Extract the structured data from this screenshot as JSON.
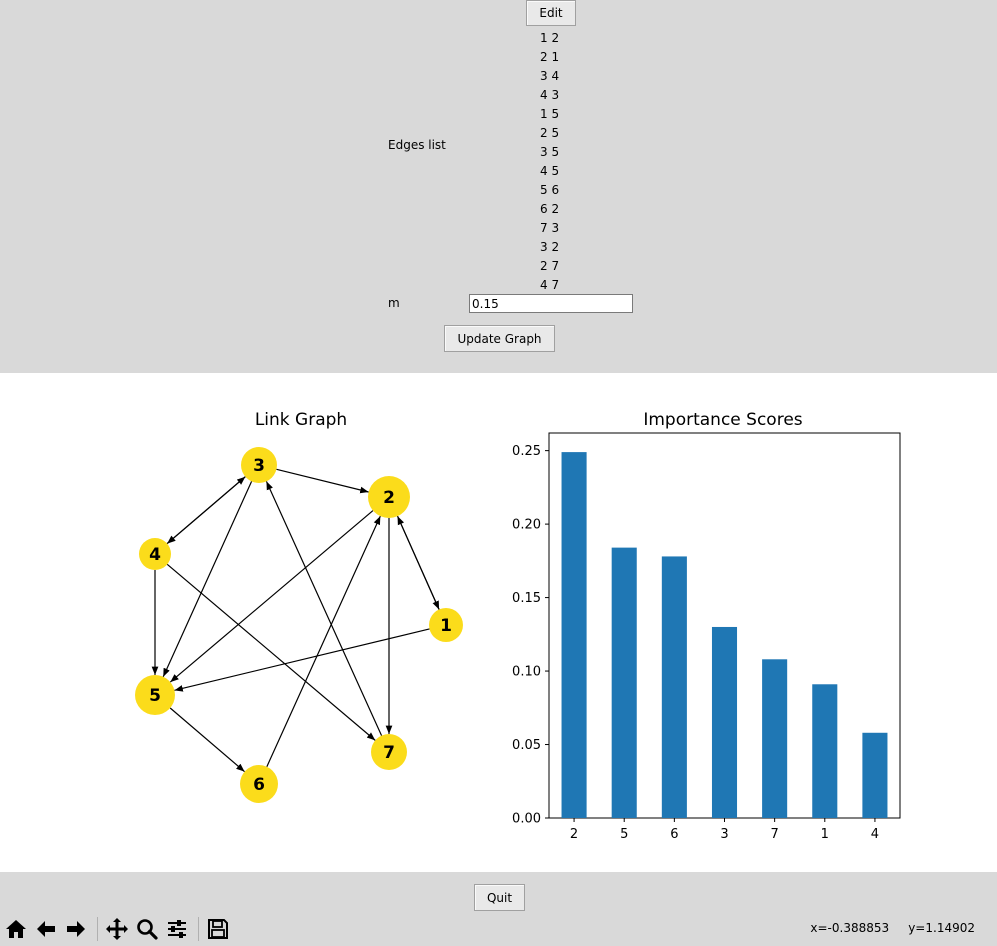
{
  "controls": {
    "edit_label": "Edit",
    "edges_label": "Edges list",
    "edges": [
      "1 2",
      "2 1",
      "3 4",
      "4 3",
      "1 5",
      "2 5",
      "3 5",
      "4 5",
      "5 6",
      "6 2",
      "7 3",
      "3 2",
      "2 7",
      "4 7"
    ],
    "m_label": "m",
    "m_value": "0.15",
    "update_label": "Update Graph"
  },
  "graph": {
    "title": "Link Graph",
    "nodes": [
      "1",
      "2",
      "3",
      "4",
      "5",
      "6",
      "7"
    ],
    "edges": [
      [
        "1",
        "2"
      ],
      [
        "2",
        "1"
      ],
      [
        "3",
        "4"
      ],
      [
        "4",
        "3"
      ],
      [
        "1",
        "5"
      ],
      [
        "2",
        "5"
      ],
      [
        "3",
        "5"
      ],
      [
        "4",
        "5"
      ],
      [
        "5",
        "6"
      ],
      [
        "6",
        "2"
      ],
      [
        "7",
        "3"
      ],
      [
        "3",
        "2"
      ],
      [
        "2",
        "7"
      ],
      [
        "4",
        "7"
      ]
    ],
    "node_color": "#fbdc1b"
  },
  "chart_data": {
    "type": "bar",
    "title": "Importance Scores",
    "categories": [
      "2",
      "5",
      "6",
      "3",
      "7",
      "1",
      "4"
    ],
    "values": [
      0.249,
      0.184,
      0.178,
      0.13,
      0.108,
      0.091,
      0.058
    ],
    "ylim": [
      0,
      0.262
    ],
    "yticks": [
      "0.00",
      "0.05",
      "0.10",
      "0.15",
      "0.20",
      "0.25"
    ],
    "ytick_values": [
      0,
      0.05,
      0.1,
      0.15,
      0.2,
      0.25
    ],
    "bar_color": "#1f77b4",
    "grid": false
  },
  "footer": {
    "quit_label": "Quit",
    "coords": "x=-0.388853     y=1.14902"
  },
  "toolbar": {
    "icons": [
      "home-icon",
      "back-icon",
      "forward-icon",
      "pan-icon",
      "zoom-icon",
      "configure-icon",
      "save-icon"
    ]
  }
}
